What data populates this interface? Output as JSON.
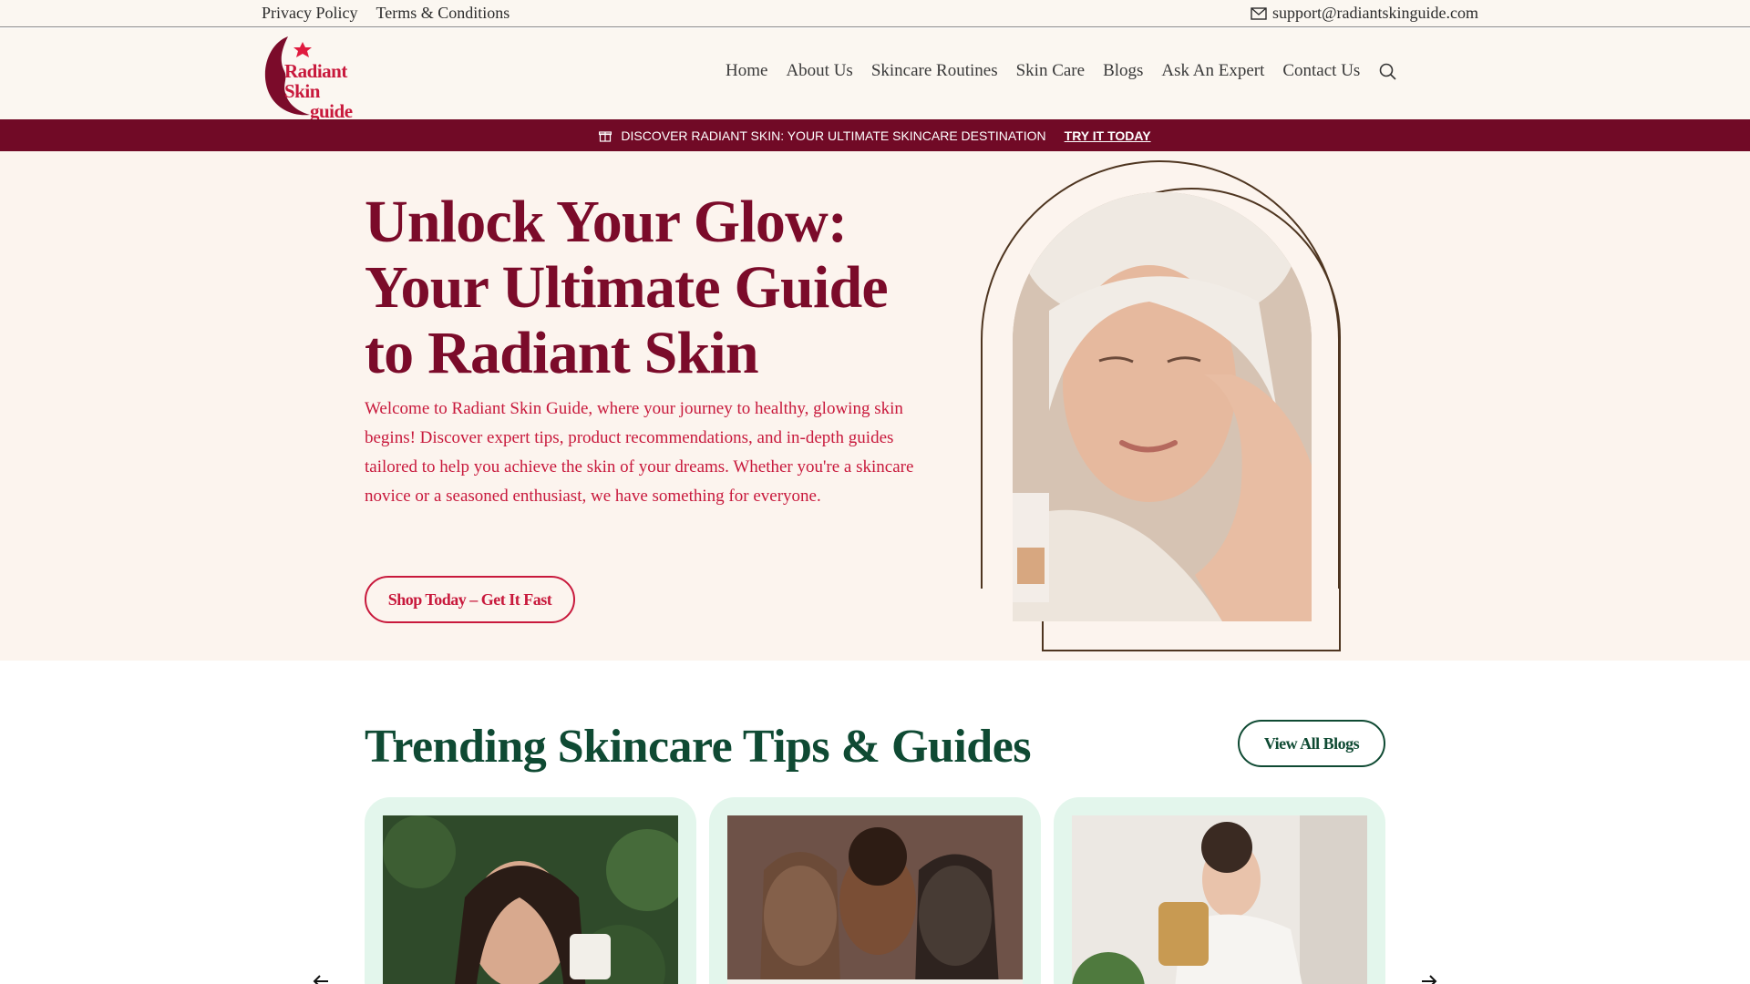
{
  "topbar": {
    "privacy": "Privacy Policy",
    "terms": "Terms & Conditions",
    "email": "support@radiantskinguide.com"
  },
  "logo": {
    "line1": "Radiant Skin",
    "line2": "guide"
  },
  "nav": {
    "items": [
      "Home",
      "About Us",
      "Skincare Routines",
      "Skin Care",
      "Blogs",
      "Ask An Expert",
      "Contact Us"
    ]
  },
  "promo": {
    "text": "DISCOVER RADIANT SKIN: YOUR ULTIMATE SKINCARE DESTINATION",
    "cta": "TRY IT TODAY"
  },
  "hero": {
    "title": "Unlock Your Glow: Your Ultimate Guide to Radiant Skin",
    "body": "Welcome to Radiant Skin Guide, where your journey to healthy, glowing skin begins! Discover expert tips, product recommendations, and in-depth guides tailored to help you achieve the skin of your dreams. Whether you're a skincare novice or a seasoned enthusiast, we have something for everyone.",
    "button": "Shop Today – Get It Fast"
  },
  "trending": {
    "title": "Trending Skincare Tips & Guides",
    "view_all": "View All Blogs"
  },
  "colors": {
    "brand_red": "#c8193c",
    "maroon": "#710a26",
    "green": "#0f4a33",
    "cream": "#fcf4ee",
    "card_mint": "#e3f6ec"
  },
  "icons": [
    "mail-icon",
    "search-icon",
    "gift-icon",
    "arrow-left-icon",
    "arrow-right-icon"
  ]
}
